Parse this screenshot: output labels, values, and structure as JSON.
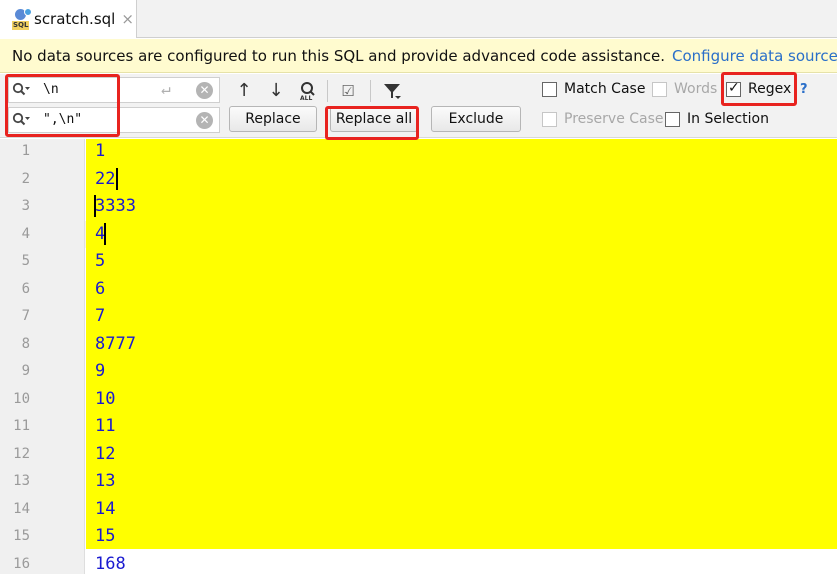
{
  "tab": {
    "filename": "scratch.sql",
    "close": "×",
    "icon": "sql-file-icon"
  },
  "banner": {
    "message": "No data sources are configured to run this SQL and provide advanced code assistance.",
    "link": "Configure data source"
  },
  "find": {
    "search_value": "\\n",
    "replace_value": "\",\\n\"",
    "enter_glyph": "↵",
    "clear_glyph": "✕"
  },
  "toolbar": {
    "prev_glyph": "↑",
    "next_glyph": "↓",
    "all_glyph": "ALL",
    "multi_glyph": "☑",
    "filter_glyph": "▼"
  },
  "buttons": {
    "replace": "Replace",
    "replace_all": "Replace all",
    "exclude": "Exclude"
  },
  "options": {
    "match_case": "Match Case",
    "words": "Words",
    "regex": "Regex",
    "preserve_case": "Preserve Case",
    "in_selection": "In Selection",
    "help": "?"
  },
  "line_numbers": [
    "1",
    "2",
    "3",
    "4",
    "5",
    "6",
    "7",
    "8",
    "9",
    "10",
    "11",
    "12",
    "13",
    "14",
    "15",
    "16"
  ],
  "code_lines": [
    "1",
    "22",
    "3333",
    "4",
    "5",
    "6",
    "7",
    "8777",
    "9",
    "10",
    "11",
    "12",
    "13",
    "14",
    "15",
    "168"
  ],
  "colors": {
    "highlight": "#ffff00",
    "code_text": "#1a1ad0",
    "link": "#2a6fc9",
    "annotation": "#e8231f"
  }
}
